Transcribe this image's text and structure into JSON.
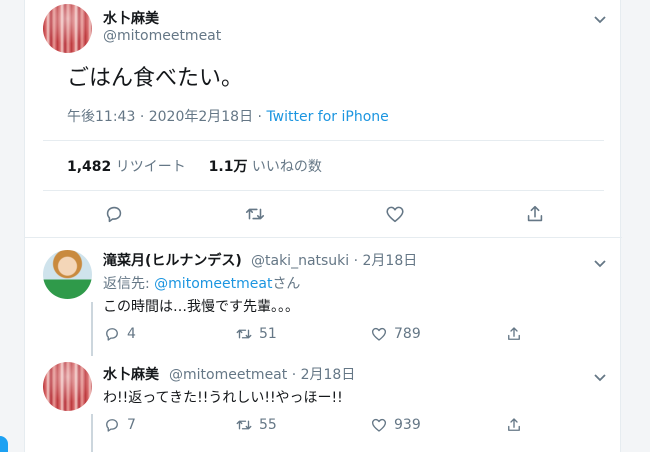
{
  "main_tweet": {
    "name": "水卜麻美",
    "handle": "@mitomeetmeat",
    "text": "ごはん食べたい。",
    "time": "午後11:43",
    "sep1": "·",
    "date": "2020年2月18日",
    "sep2": "·",
    "source": "Twitter for iPhone",
    "retweets_count": "1,482",
    "retweets_label": "リツイート",
    "likes_count": "1.1万",
    "likes_label": "いいねの数"
  },
  "replies": [
    {
      "name": "滝菜月(ヒルナンデス)",
      "handle": "@taki_natsuki · 2月18日",
      "reply_prefix": "返信先:",
      "reply_mention": "@mitomeetmeat",
      "reply_suffix": "さん",
      "text": "この時間は…我慢です先輩。。。",
      "reply_count": "4",
      "retweet_count": "51",
      "like_count": "789"
    },
    {
      "name": "水卜麻美",
      "handle": "@mitomeetmeat · 2月18日",
      "text": "わ!!返ってきた!!うれしい!!やっほー!!",
      "reply_count": "7",
      "retweet_count": "55",
      "like_count": "939"
    }
  ],
  "colors": {
    "accent": "#1b95e0",
    "muted": "#657786",
    "divider": "#e6ecf0"
  },
  "icons": [
    "reply-icon",
    "retweet-icon",
    "like-icon",
    "share-icon",
    "chevron-down-icon"
  ]
}
